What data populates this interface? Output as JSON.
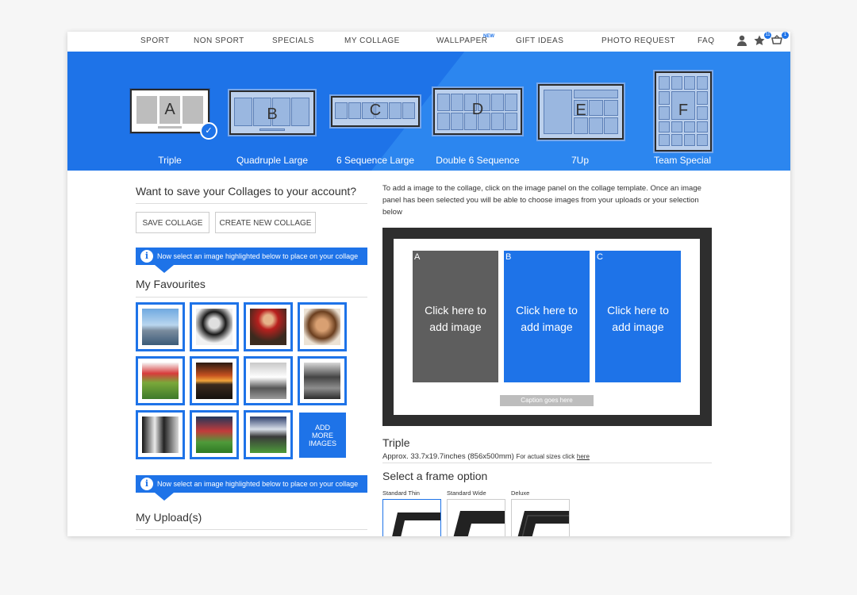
{
  "nav": {
    "items": [
      "SPORT",
      "NON SPORT",
      "SPECIALS",
      "MY COLLAGE",
      "WALLPAPER",
      "GIFT IDEAS",
      "PHOTO REQUEST",
      "FAQ"
    ],
    "new_badge": "NEW",
    "favourites_count": "11",
    "basket_count": "1"
  },
  "templates": [
    {
      "letter": "A",
      "name": "Triple",
      "selected": true
    },
    {
      "letter": "B",
      "name": "Quadruple Large"
    },
    {
      "letter": "C",
      "name": "6 Sequence Large"
    },
    {
      "letter": "D",
      "name": "Double 6 Sequence"
    },
    {
      "letter": "E",
      "name": "7Up"
    },
    {
      "letter": "F",
      "name": "Team Special"
    }
  ],
  "left": {
    "save_title": "Want to save your Collages to your account?",
    "save_button": "SAVE COLLAGE",
    "create_button": "CREATE NEW COLLAGE",
    "info_text": "Now select an image highlighted below to place on your collage",
    "favourites_title": "My Favourites",
    "add_more": [
      "ADD",
      "MORE",
      "IMAGES"
    ],
    "uploads_title": "My Upload(s)"
  },
  "right": {
    "description": "To add a image to the collage, click on the image panel on the collage template. Once an image panel has been selected you will be able to choose images from your uploads or your selection below",
    "panels": [
      {
        "letter": "A",
        "line1": "Click here to",
        "line2": "add image"
      },
      {
        "letter": "B",
        "line1": "Click here to",
        "line2": "add image"
      },
      {
        "letter": "C",
        "line1": "Click here to",
        "line2": "add image"
      }
    ],
    "caption": "Caption goes here",
    "size_title": "Triple",
    "size_text": "Approx. 33.7x19.7inches (856x500mm)",
    "size_note": "For actual sizes click",
    "size_link": "here",
    "frame_title": "Select a frame option",
    "frames": [
      "Standard Thin",
      "Standard Wide",
      "Deluxe"
    ]
  },
  "colors": {
    "accent": "#1e73e8",
    "panel_selected": "#5e5e5e",
    "frame_dark": "#2e2e2e"
  }
}
